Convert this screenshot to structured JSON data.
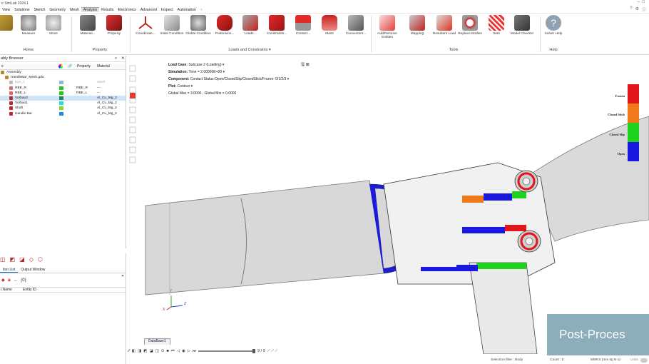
{
  "title": "ır SimLab 2024.1",
  "menu": [
    "View",
    "Solutions",
    "Sketch",
    "Geometry",
    "Mesh",
    "Analysis",
    "Results",
    "Electronics",
    "Advanced",
    "Inspect",
    "Automation"
  ],
  "menu_active": "Analysis",
  "ribbon": {
    "groups": [
      "Home",
      "Property",
      "Loads and Constraints",
      "Tools",
      "Help"
    ],
    "home_tools": [
      "",
      "Measure",
      "Move"
    ],
    "property_tools": [
      "Material...",
      "Property"
    ],
    "loads_tools": [
      "Coordinate...",
      "Initial Condition",
      "Global Condition",
      "Pretension...",
      "Loads...",
      "Constraints...",
      "Contact...",
      "Mass",
      "Connectors..."
    ],
    "tools_tools": [
      "Add/Remove Entities",
      "Mapping",
      "Resultant Load",
      "Replace Bodies",
      "Sets",
      "Model Checker"
    ],
    "help_tools": [
      "Solver Help"
    ]
  },
  "browser": {
    "title": "ably Browser",
    "col_property": "Property",
    "col_material": "Material",
    "tree": [
      {
        "label": "Assembly",
        "indent": 0,
        "prop": "",
        "mat": "",
        "color": "",
        "icon": "assembly"
      },
      {
        "label": "HandleBar_Mesh.gda",
        "indent": 1,
        "prop": "",
        "mat": "",
        "color": "",
        "icon": "file"
      },
      {
        "label": "Eye_1",
        "indent": 2,
        "prop": "",
        "mat": "Steel",
        "color": "#8fb4e0",
        "icon": "eye",
        "faded": true
      },
      {
        "label": "RBE_R",
        "indent": 2,
        "prop": "RBE_R",
        "mat": "---",
        "color": "#22c81e",
        "icon": "rbe"
      },
      {
        "label": "RBE_L",
        "indent": 2,
        "prop": "RBE_L",
        "mat": "---",
        "color": "#22c81e",
        "icon": "rbe"
      },
      {
        "label": "Vorbau2",
        "indent": 2,
        "prop": "",
        "mat": "Al_Cu_Mg_2",
        "color": "#1c8a5a",
        "icon": "cube",
        "selected": true
      },
      {
        "label": "Vorbau1",
        "indent": 2,
        "prop": "",
        "mat": "Al_Cu_Mg_2",
        "color": "#1ee0e8",
        "icon": "cube"
      },
      {
        "label": "Shaft",
        "indent": 2,
        "prop": "",
        "mat": "Al_Cu_Mg_2",
        "color": "#8ed81e",
        "icon": "cube"
      },
      {
        "label": "Handle Bar",
        "indent": 2,
        "prop": "",
        "mat": "Al_Cu_Mg_2",
        "color": "#1a8fd8",
        "icon": "cube"
      }
    ]
  },
  "lower_panel": {
    "tabs": [
      "tion List",
      "Output Window"
    ],
    "counter": "(0)",
    "col_name": "l Name",
    "col_entity": "Entity ID"
  },
  "viewport": {
    "load_case_label": "Load Case:",
    "load_case": "Subcase 2 (Loading)",
    "simulation_label": "Simulation:",
    "simulation": "Time = 2.00000E+00",
    "component_label": "Component:",
    "component": "Contact Status:Open/ClosedSlip/ClosedStick/Frozen: 0/1/2/3",
    "plot_label": "Plot:",
    "plot": "Contour",
    "global": "Global Max = 3.0000 , Global Min = 0.0000",
    "legend": [
      {
        "label": "Frozen",
        "color": "#e0161a"
      },
      {
        "label": "Closed Stick",
        "color": "#f07a1a"
      },
      {
        "label": "Closed Slip",
        "color": "#1ed21e"
      },
      {
        "label": "Open",
        "color": "#1818e0"
      }
    ],
    "watermark": "Post-Proces",
    "axis": {
      "y": "Y",
      "z": "Z",
      "x": "X"
    }
  },
  "animation": {
    "tab": "DataBase1",
    "frame": "9 / 9"
  },
  "status": {
    "selection_filter": "Selection filter : Body",
    "count": "Count : 0",
    "units": "MMKS (mm kg N s)",
    "units_toggle": "Units"
  }
}
